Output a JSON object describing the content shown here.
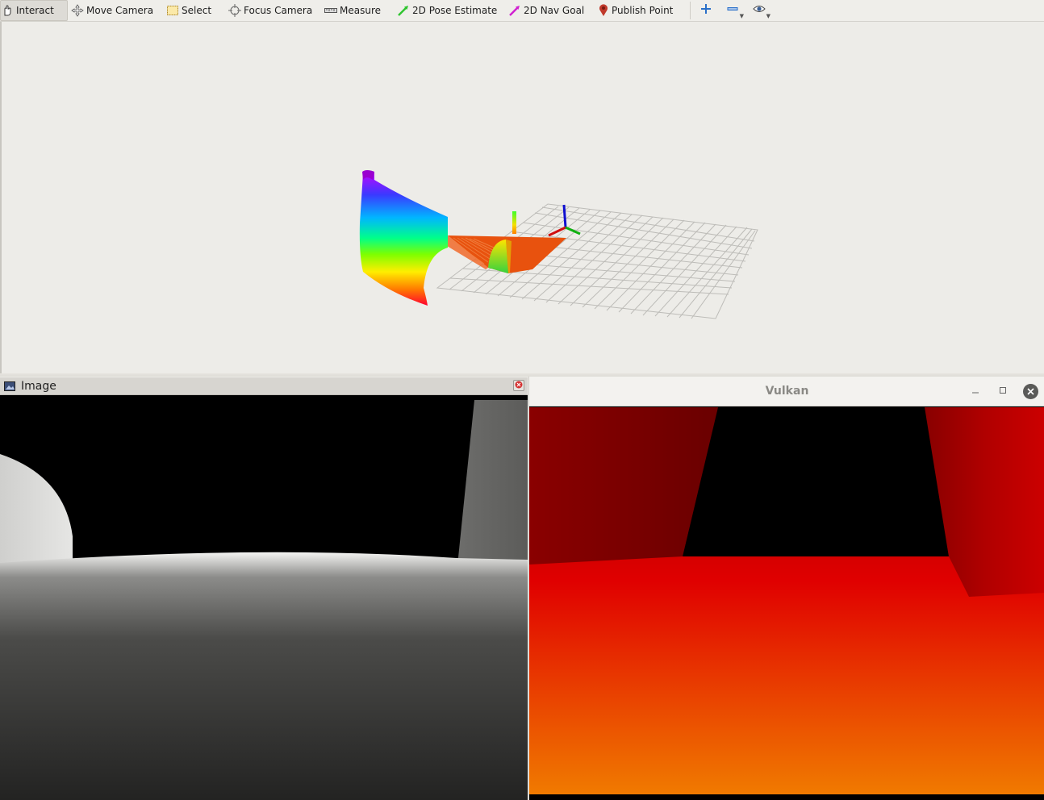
{
  "toolbar": {
    "tools": [
      {
        "label": "Interact",
        "icon": "hand-pointer-icon",
        "active": true
      },
      {
        "label": "Move Camera",
        "icon": "move-camera-icon"
      },
      {
        "label": "Select",
        "icon": "select-box-icon"
      },
      {
        "label": "Focus Camera",
        "icon": "crosshair-icon"
      },
      {
        "label": "Measure",
        "icon": "ruler-icon"
      },
      {
        "label": "2D Pose Estimate",
        "icon": "green-arrow-icon"
      },
      {
        "label": "2D Nav Goal",
        "icon": "magenta-arrow-icon"
      },
      {
        "label": "Publish Point",
        "icon": "map-pin-icon"
      }
    ],
    "icons": [
      "plus-icon",
      "minus-icon",
      "eye-icon"
    ]
  },
  "image_panel": {
    "title": "Image"
  },
  "vulkan_window": {
    "title": "Vulkan"
  },
  "colors": {
    "toolbar_bg": "#efeeea",
    "viewport_bg": "#edece8",
    "accent_orange": "#e85a10",
    "vulkan_red": "#e00000"
  }
}
